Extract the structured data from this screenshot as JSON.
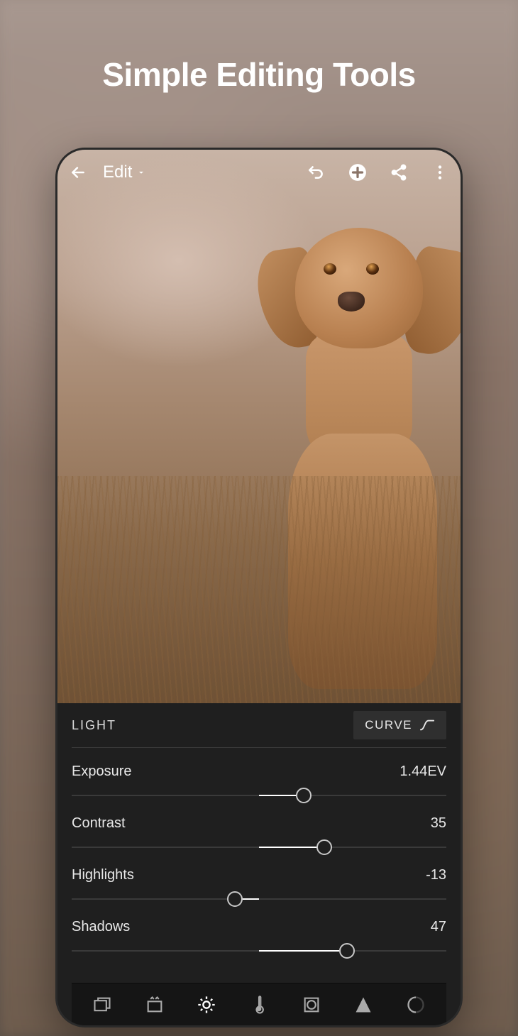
{
  "headline": "Simple Editing Tools",
  "toolbar": {
    "mode_label": "Edit"
  },
  "panel": {
    "title": "LIGHT",
    "curve_label": "CURVE"
  },
  "sliders": [
    {
      "label": "Exposure",
      "value_text": "1.44EV",
      "center": 50,
      "pos": 62
    },
    {
      "label": "Contrast",
      "value_text": "35",
      "center": 50,
      "pos": 67.5
    },
    {
      "label": "Highlights",
      "value_text": "-13",
      "center": 50,
      "pos": 43.5
    },
    {
      "label": "Shadows",
      "value_text": "47",
      "center": 50,
      "pos": 73.5
    }
  ],
  "bottom_tools": [
    {
      "name": "presets-icon",
      "active": false
    },
    {
      "name": "healing-icon",
      "active": false
    },
    {
      "name": "light-icon",
      "active": true
    },
    {
      "name": "color-temp-icon",
      "active": false
    },
    {
      "name": "effects-icon",
      "active": false
    },
    {
      "name": "detail-icon",
      "active": false
    },
    {
      "name": "optics-icon",
      "active": false
    }
  ]
}
